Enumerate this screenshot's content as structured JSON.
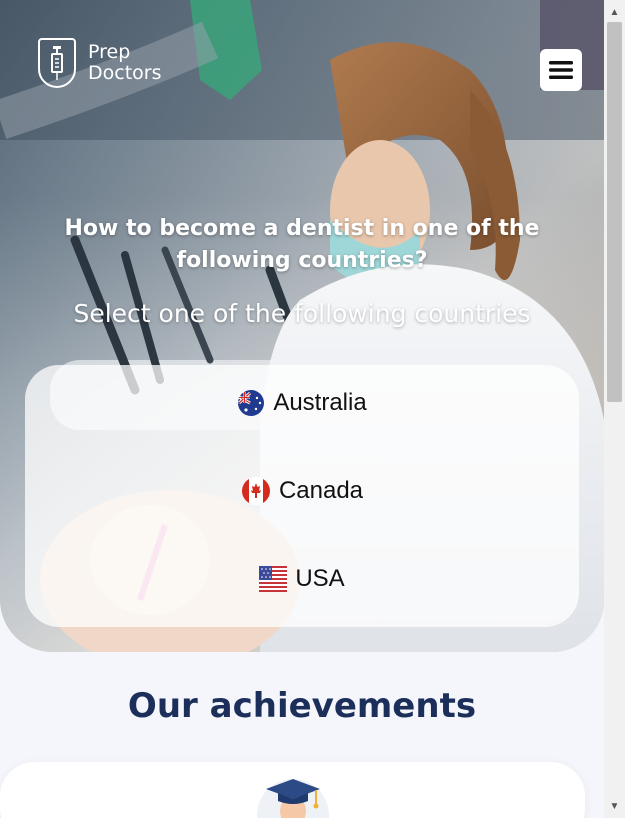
{
  "header": {
    "logo_line1": "Prep",
    "logo_line2": "Doctors",
    "menu_icon": "hamburger-menu-icon"
  },
  "hero": {
    "title": "How to become a dentist in one of the following countries?",
    "subtitle": "Select one of the following countries"
  },
  "countries": [
    {
      "name": "Australia",
      "flag": "australia-flag-icon"
    },
    {
      "name": "Canada",
      "flag": "canada-flag-icon"
    },
    {
      "name": "USA",
      "flag": "usa-flag-icon"
    }
  ],
  "achievements": {
    "title": "Our achievements",
    "icon": "graduate-icon"
  },
  "colors": {
    "brand_navy": "#1c2f5b",
    "page_bg": "#f4f6fb"
  }
}
